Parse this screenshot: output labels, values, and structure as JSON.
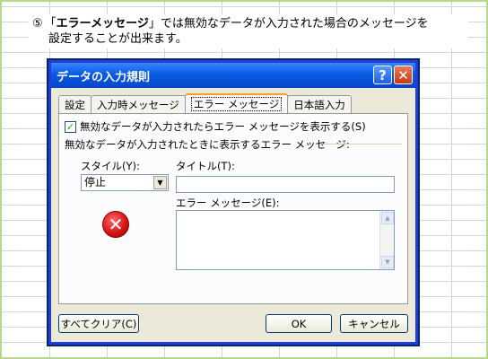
{
  "caption": {
    "number": "⑤",
    "quote_open": "「",
    "bold_term": "エラーメッセージ",
    "quote_close": "」",
    "line1_rest": "では無効なデータが入力された場合のメッセージを",
    "line2": "設定することが出来ます。"
  },
  "dialog": {
    "title": "データの入力規則",
    "help_glyph": "?",
    "close_glyph": "✕",
    "tabs": [
      {
        "label": "設定"
      },
      {
        "label": "入力時メッセージ"
      },
      {
        "label": "エラー メッセージ"
      },
      {
        "label": "日本語入力"
      }
    ],
    "active_tab": "エラー メッセージ",
    "checkbox": {
      "checked": true,
      "mark": "✓",
      "label": "無効なデータが入力されたらエラー メッセージを表示する(S)"
    },
    "group_label": "無効なデータが入力されたときに表示するエラー メッセージ:",
    "style_label": "スタイル(Y):",
    "style_value": "停止",
    "title_label": "タイトル(T):",
    "title_value": "",
    "message_label": "エラー メッセージ(E):",
    "message_value": "",
    "error_glyph": "✕",
    "buttons": {
      "clear": "すべてクリア(C)",
      "ok": "OK",
      "cancel": "キャンセル"
    }
  },
  "colors": {
    "frame_border": "#b7d68e",
    "titlebar": "#0a5ae4",
    "active_tab_accent": "#f3a12b",
    "error_icon": "#d01010"
  }
}
